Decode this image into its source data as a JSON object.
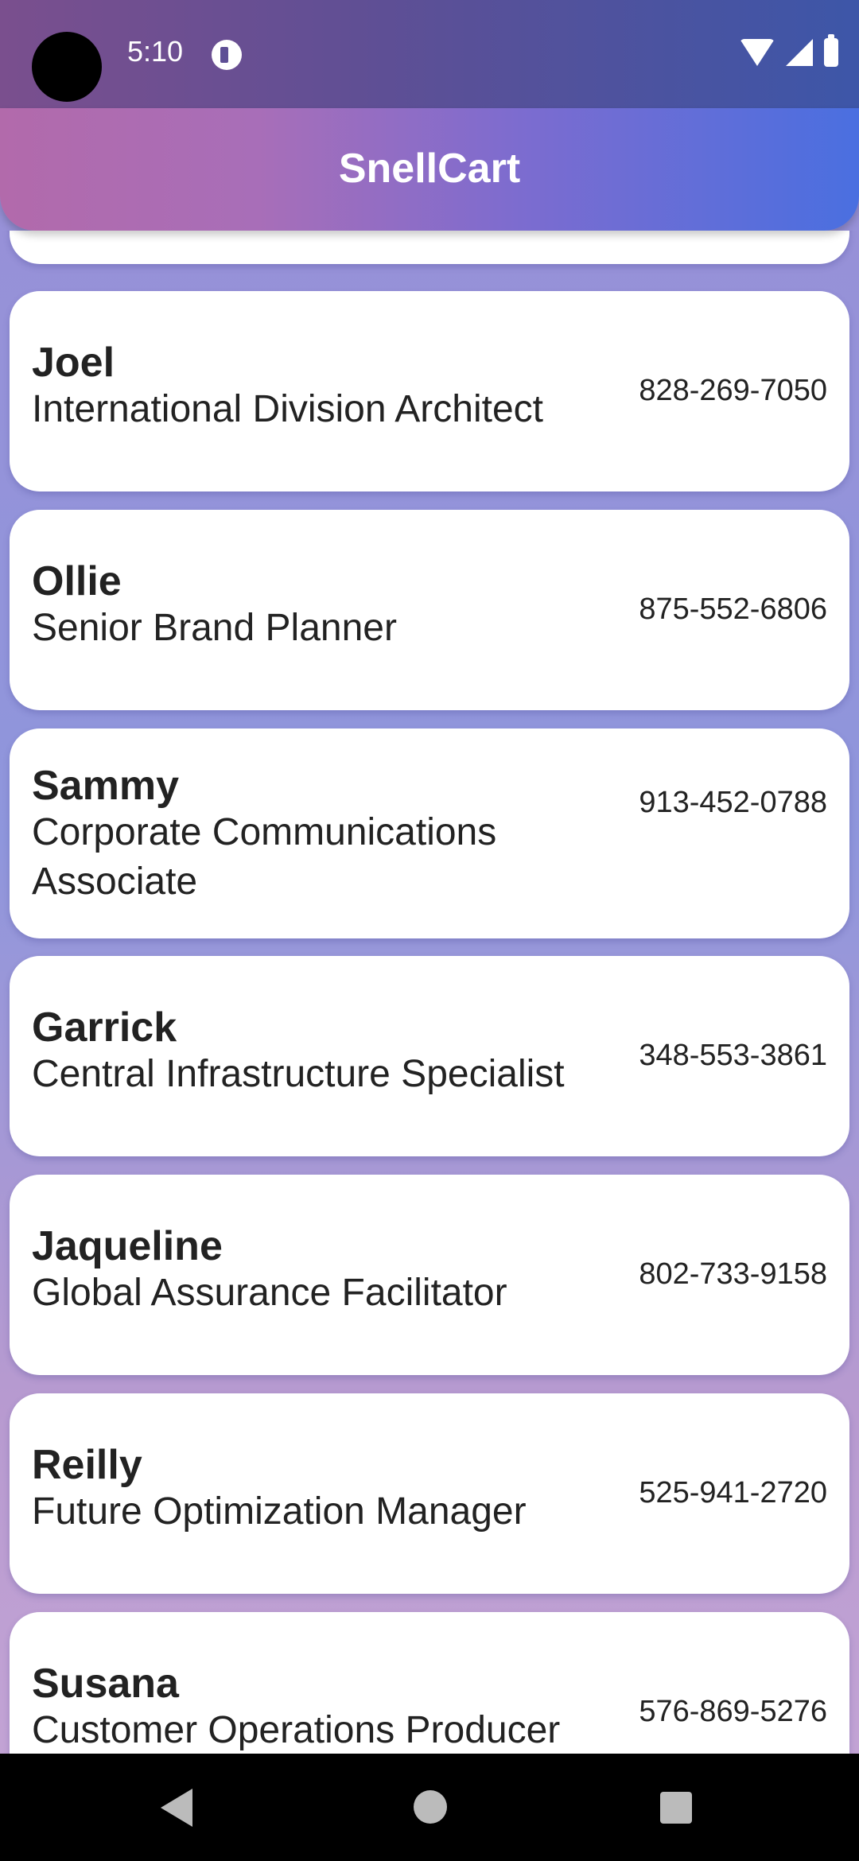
{
  "status_bar": {
    "time": "5:10"
  },
  "app_bar": {
    "title": "SnellCart"
  },
  "contacts": [
    {
      "name": "Joel",
      "title": "International Division Architect",
      "phone": "828-269-7050"
    },
    {
      "name": "Ollie",
      "title": "Senior Brand Planner",
      "phone": "875-552-6806"
    },
    {
      "name": "Sammy",
      "title": "Corporate Communications Associate",
      "phone": "913-452-0788"
    },
    {
      "name": "Garrick",
      "title": "Central Infrastructure Specialist",
      "phone": "348-553-3861"
    },
    {
      "name": "Jaqueline",
      "title": "Global Assurance Facilitator",
      "phone": "802-733-9158"
    },
    {
      "name": "Reilly",
      "title": "Future Optimization Manager",
      "phone": "525-941-2720"
    },
    {
      "name": "Susana",
      "title": "Customer Operations Producer",
      "phone": "576-869-5276"
    }
  ]
}
